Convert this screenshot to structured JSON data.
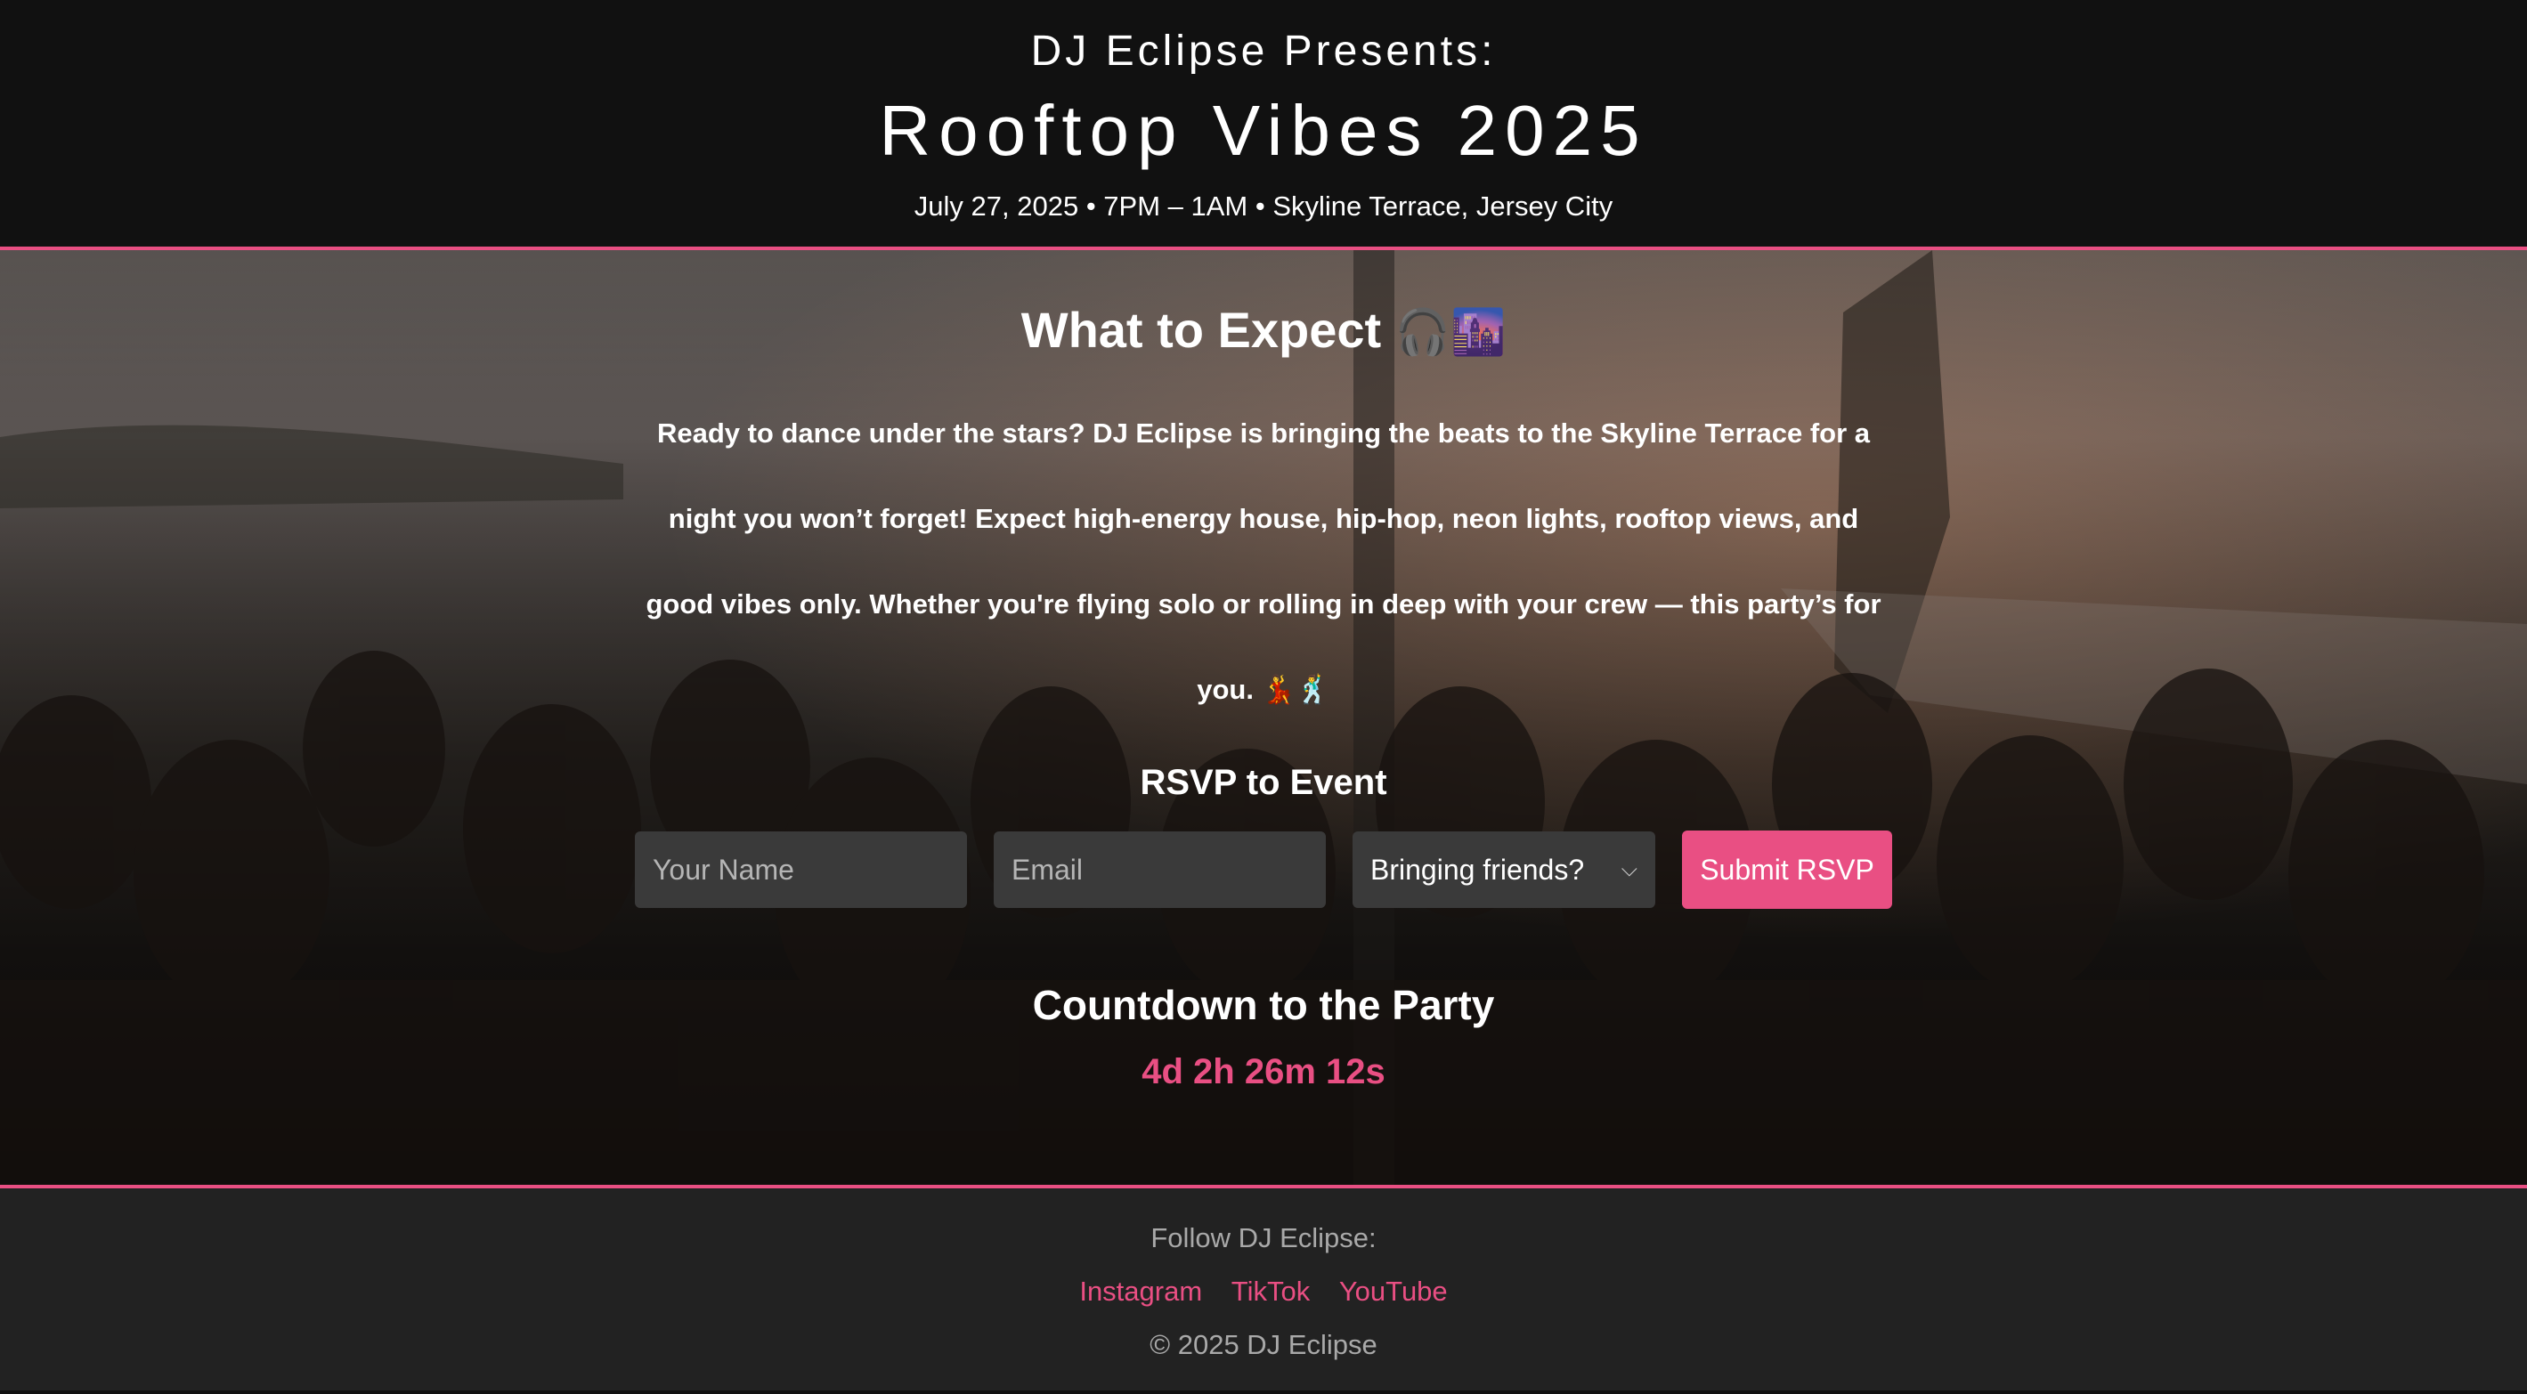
{
  "header": {
    "presenter": "DJ Eclipse Presents:",
    "title": "Rooftop Vibes 2025",
    "meta": "July 27, 2025 • 7PM – 1AM • Skyline Terrace, Jersey City"
  },
  "main": {
    "expect_heading": "What to Expect",
    "expect_emoji": "🎧🌆",
    "description": "Ready to dance under the stars? DJ Eclipse is bringing the beats to the Skyline Terrace for a night you won’t forget! Expect high-energy house, hip-hop, neon lights, rooftop views, and good vibes only. Whether you're flying solo or rolling in deep with your crew — this party’s for you. 💃🕺",
    "rsvp_heading": "RSVP to Event",
    "rsvp": {
      "name_placeholder": "Your Name",
      "email_placeholder": "Email",
      "friends_selected": "Bringing friends?",
      "submit_label": "Submit RSVP"
    },
    "countdown_heading": "Countdown to the Party",
    "countdown_value": "4d 2h 26m 12s"
  },
  "footer": {
    "follow_label": "Follow DJ Eclipse:",
    "links": [
      "Instagram",
      "TikTok",
      "YouTube"
    ],
    "copyright": "© 2025 DJ Eclipse"
  },
  "colors": {
    "accent": "#e94f83",
    "header_bg": "#111111",
    "footer_bg": "#222222"
  }
}
